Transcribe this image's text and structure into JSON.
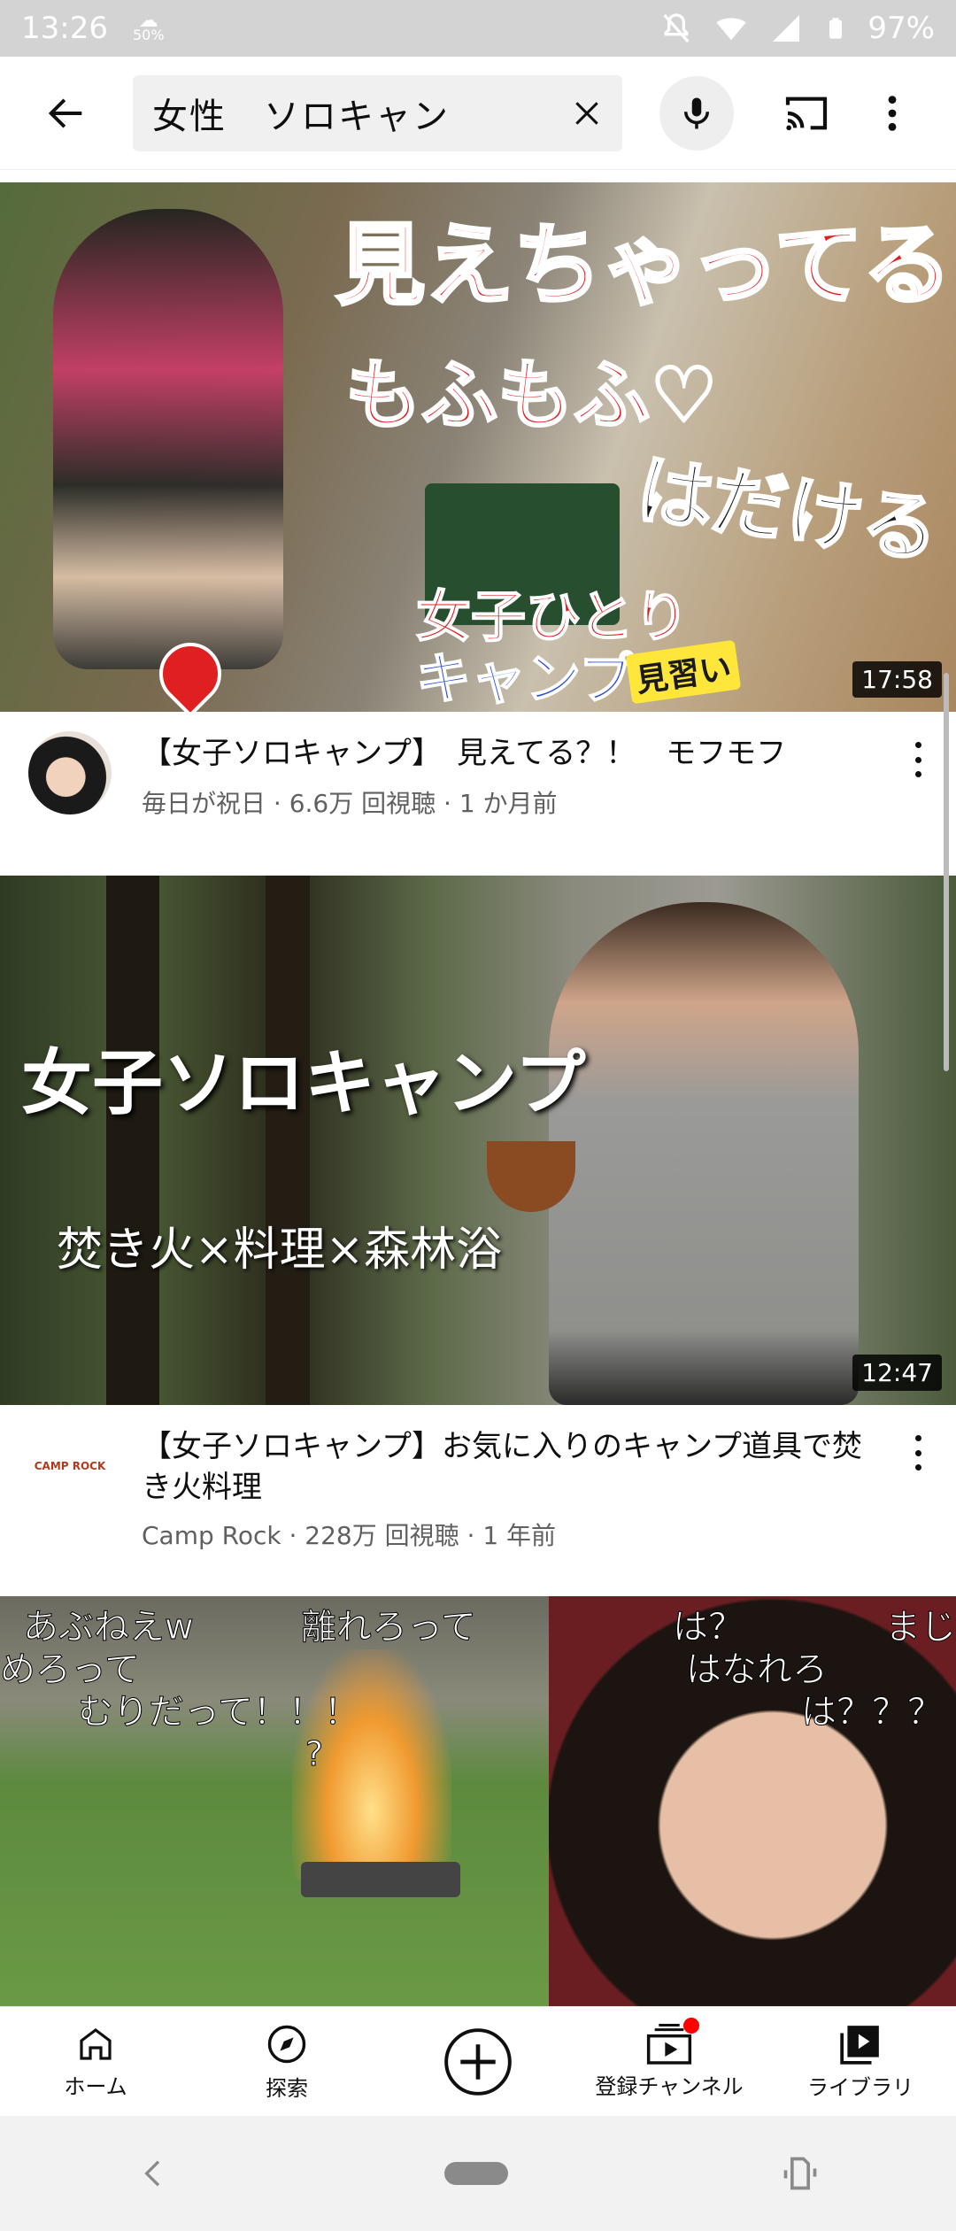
{
  "status_bar": {
    "time": "13:26",
    "battery": "97%",
    "hint_small": "50%"
  },
  "search": {
    "query": "女性　ソロキャン"
  },
  "videos": [
    {
      "title": "【女子ソロキャンプ】　見えてる？！　モフモフ",
      "channel_line": "毎日が祝日 · 6.6万 回視聴 · 1 か月前",
      "duration": "17:58",
      "overlay": [
        "見えちゃってる",
        "もふもふ♡",
        "はだける",
        "女子ひとり",
        "キャンプ",
        "見習い"
      ]
    },
    {
      "title": "【女子ソロキャンプ】お気に入りのキャンプ道具で焚き火料理",
      "channel_line": "Camp Rock · 228万 回視聴 · 1 年前",
      "duration": "12:47",
      "avatar_text": "CAMP ROCK",
      "overlay": [
        "女子ソロキャンプ",
        "焚き火×料理×森林浴"
      ]
    },
    {
      "overlay": [
        "あぶねえw",
        "離れろって",
        "は？",
        "まじ",
        "めろって",
        "はなれろ",
        "むりだって！！！",
        "は？？？",
        "?"
      ]
    }
  ],
  "bottom_nav": {
    "home": "ホーム",
    "explore": "探索",
    "subscriptions": "登録チャンネル",
    "library": "ライブラリ"
  },
  "colors": {
    "accent_red": "#ff0000",
    "text_secondary": "#606060"
  }
}
